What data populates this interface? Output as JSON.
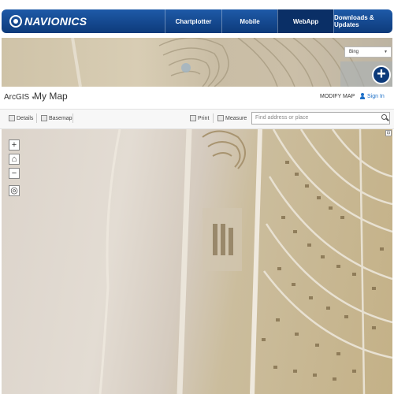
{
  "navionics": {
    "logo": "NAVIONICS",
    "links": [
      {
        "label": "Chartplotter",
        "active": false
      },
      {
        "label": "Mobile",
        "active": false
      },
      {
        "label": "WebApp",
        "active": true
      },
      {
        "label": "Downloads & Updates",
        "active": false
      }
    ],
    "brand_color": "#1e5aa8"
  },
  "banner": {
    "basemap_select": "Bing",
    "add_button": "+"
  },
  "arcgis": {
    "brand": "ArcGIS",
    "title": "My Map",
    "modify_map": "MODIFY MAP",
    "sign_in": "Sign In"
  },
  "toolbar": {
    "details": "Details",
    "basemap": "Basemap",
    "print": "Print",
    "measure": "Measure",
    "address_placeholder": "Find address or place"
  },
  "map_controls": {
    "zoom_in": "+",
    "zoom_out": "−"
  }
}
